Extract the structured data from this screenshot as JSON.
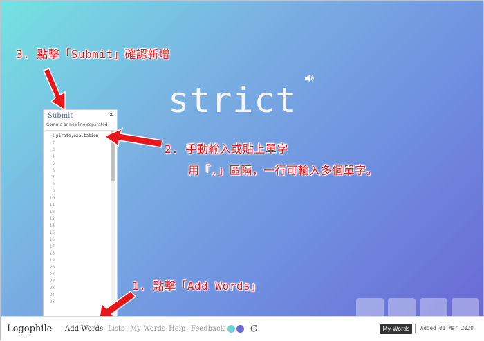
{
  "word": {
    "text": "strict"
  },
  "panel": {
    "title": "Submit",
    "close": "✕",
    "hint": "Comma or newline separated",
    "first_line": "pirate,exaltation",
    "line_count": 25
  },
  "annotations": {
    "step3": "3. 點擊「Submit」確認新增",
    "step2_line1": "2. 手動輸入或貼上單字",
    "step2_line2": "用「,」區隔，一行可輸入多個單字。",
    "step1": "1. 點擊「Add Words」"
  },
  "footer": {
    "brand": "Logophile",
    "nav": {
      "add_words": "Add Words",
      "lists": "Lists",
      "my_words": "My Words",
      "help": "Help",
      "feedback": "Feedback"
    },
    "theme_colors": [
      "#6ed3d6",
      "#6a6fd8"
    ],
    "mywords_button": "My Words",
    "added": "Added 01 Mar 2020"
  },
  "colors": {
    "annotation": "#e8151b",
    "footer_button": "#333333"
  }
}
